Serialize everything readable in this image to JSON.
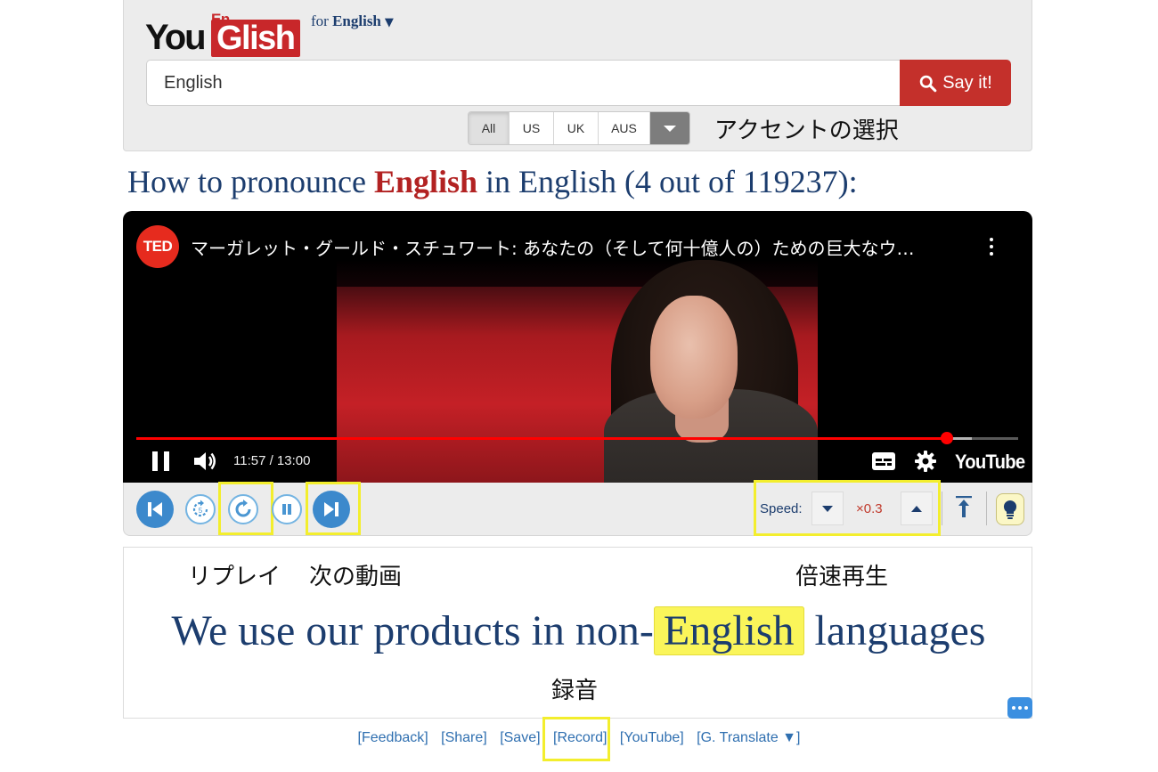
{
  "header": {
    "logo_en": "En",
    "logo_you": "You",
    "logo_glish": "Glish",
    "for_prefix": "for",
    "language": "English",
    "language_caret": "▼"
  },
  "search": {
    "value": "English",
    "placeholder": "",
    "button_label": "Say it!"
  },
  "accents": {
    "options": [
      "All",
      "US",
      "UK",
      "AUS"
    ],
    "selected": "All",
    "note": "アクセントの選択"
  },
  "title": {
    "prefix": "How to pronounce",
    "word": "English",
    "suffix": "in English (4 out of 119237):"
  },
  "video": {
    "channel_badge": "TED",
    "title": "マーガレット・グールド・スチュワート: あなたの（そして何十億人の）ための巨大なウ…",
    "time": "11:57 / 13:00",
    "progress": 0.919,
    "buffered": 0.947,
    "brand": "YouTube",
    "colors": {
      "progress": "#ff0000",
      "ted": "#e62b1e"
    }
  },
  "controls": {
    "speed_label": "Speed:",
    "speed_value": "×0.3",
    "icons": [
      "previous-icon",
      "back-5s-icon",
      "replay-icon",
      "pause-icon",
      "next-icon",
      "scroll-top-icon",
      "lightbulb-icon"
    ]
  },
  "notes": {
    "replay": "リプレイ",
    "next_video": "次の動画",
    "speed": "倍速再生",
    "record": "録音"
  },
  "caption": {
    "before": "We use our products in non-",
    "highlight": "English",
    "after": " languages"
  },
  "footer": {
    "links": [
      "[Feedback]",
      "[Share]",
      "[Save]",
      "[Record]",
      "[YouTube]",
      "[G. Translate ▼]"
    ]
  },
  "colors": {
    "brand_red": "#c8272a",
    "navy": "#1c3d6e",
    "control_blue": "#3c89cc",
    "annotation_yellow": "#f3ee2d",
    "caption_highlight": "#faf55a"
  }
}
